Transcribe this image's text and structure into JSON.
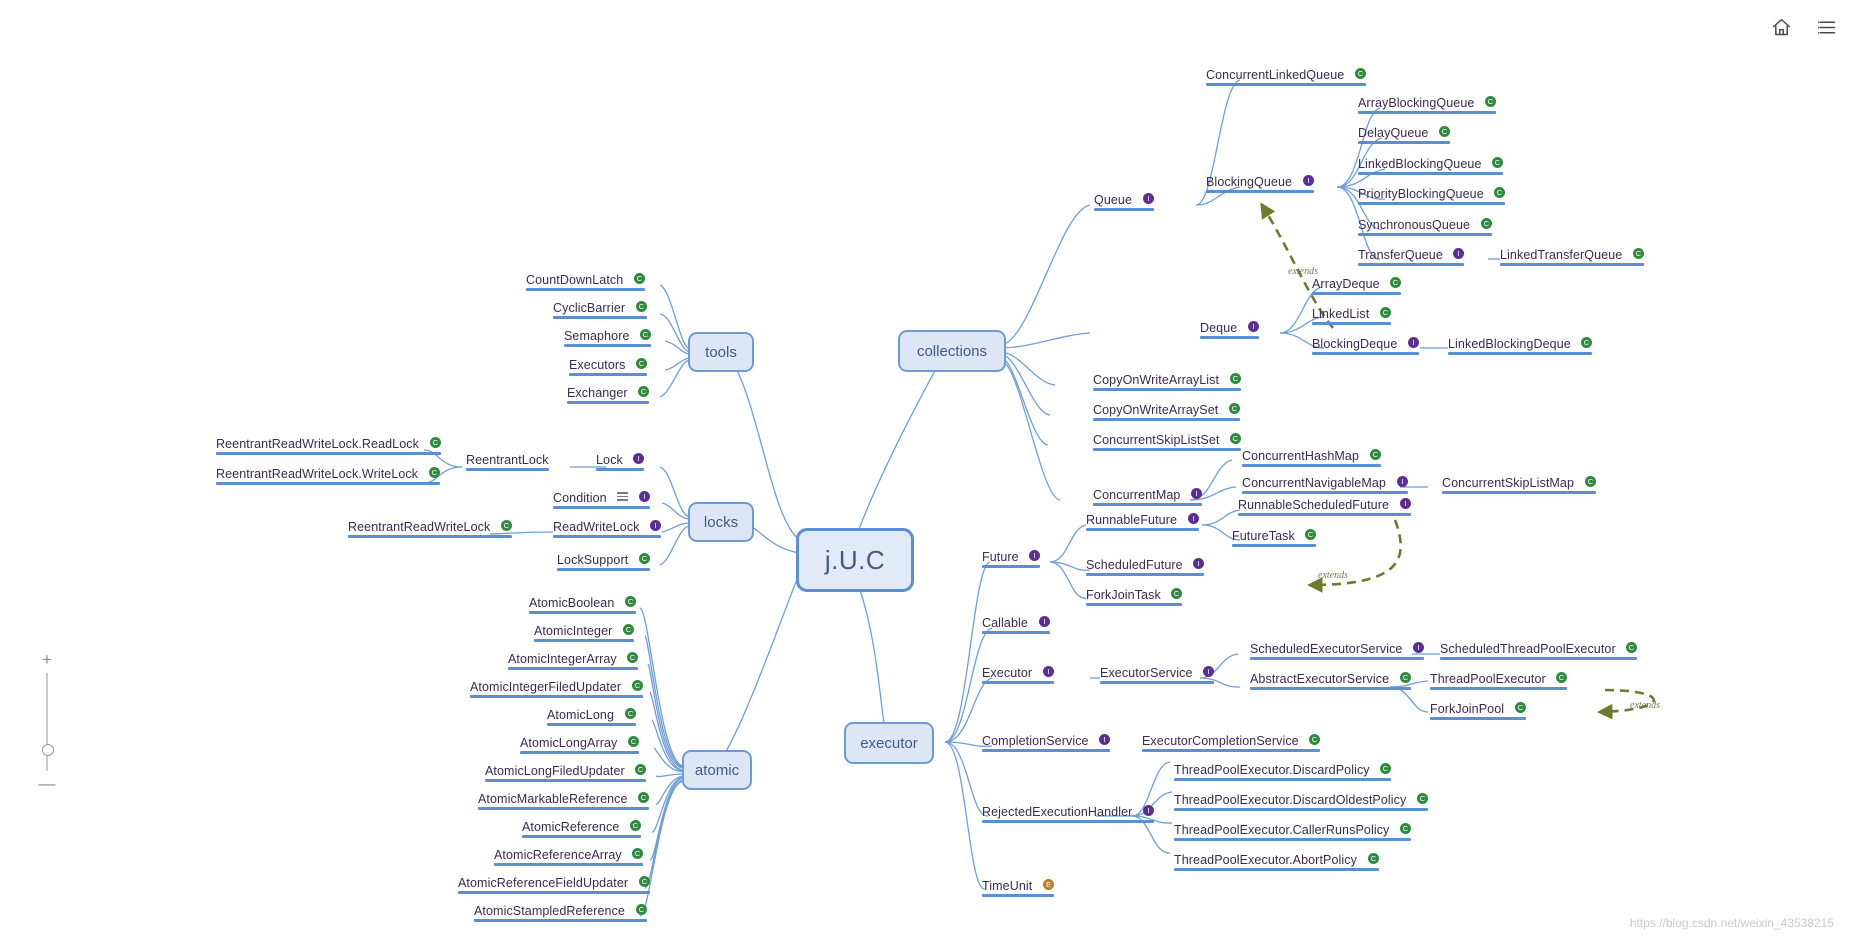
{
  "root": {
    "label": "j.U.C"
  },
  "toolbar": {
    "home_icon": "home-icon",
    "menu_icon": "list-menu-icon"
  },
  "zoom": {
    "plus": "+",
    "minus": "—"
  },
  "watermark": "https://blog.csdn.net/weixin_43538215",
  "relations": [
    {
      "label": "extends",
      "from": "ArrayDeque",
      "to": "BlockingQueue"
    },
    {
      "label": "extends",
      "from": "RunnableScheduledFuture",
      "to": "ScheduledFuture"
    },
    {
      "label": "extends",
      "from": "ThreadPoolExecutor",
      "to": "ScheduledThreadPoolExecutor"
    }
  ],
  "branches": {
    "tools": {
      "label": "tools"
    },
    "locks": {
      "label": "locks"
    },
    "atomic": {
      "label": "atomic"
    },
    "collections": {
      "label": "collections"
    },
    "executor": {
      "label": "executor"
    }
  },
  "nodes": {
    "tools_children": [
      {
        "label": "CountDownLatch",
        "kind": "class"
      },
      {
        "label": "CyclicBarrier",
        "kind": "class"
      },
      {
        "label": "Semaphore",
        "kind": "class"
      },
      {
        "label": "Executors",
        "kind": "class"
      },
      {
        "label": "Exchanger",
        "kind": "class"
      }
    ],
    "locks_children": [
      {
        "label": "Lock",
        "kind": "interface"
      },
      {
        "label": "Condition",
        "kind": "interface",
        "menu": true
      },
      {
        "label": "ReadWriteLock",
        "kind": "interface"
      },
      {
        "label": "LockSupport",
        "kind": "class"
      }
    ],
    "lock_children": [
      {
        "label": "ReentrantLock",
        "kind": "none"
      }
    ],
    "reentrantlock_children": [
      {
        "label": "ReentrantReadWriteLock.ReadLock",
        "kind": "class"
      },
      {
        "label": "ReentrantReadWriteLock.WriteLock",
        "kind": "class"
      }
    ],
    "readwritelock_children": [
      {
        "label": "ReentrantReadWriteLock",
        "kind": "class"
      }
    ],
    "atomic_children": [
      {
        "label": "AtomicBoolean",
        "kind": "class"
      },
      {
        "label": "AtomicInteger",
        "kind": "class"
      },
      {
        "label": "AtomicIntegerArray",
        "kind": "class"
      },
      {
        "label": "AtomicIntegerFiledUpdater",
        "kind": "class"
      },
      {
        "label": "AtomicLong",
        "kind": "class"
      },
      {
        "label": "AtomicLongArray",
        "kind": "class"
      },
      {
        "label": "AtomicLongFiledUpdater",
        "kind": "class"
      },
      {
        "label": "AtomicMarkableReference",
        "kind": "class"
      },
      {
        "label": "AtomicReference",
        "kind": "class"
      },
      {
        "label": "AtomicReferenceArray",
        "kind": "class"
      },
      {
        "label": "AtomicReferenceFieldUpdater",
        "kind": "class"
      },
      {
        "label": "AtomicStampledReference",
        "kind": "class"
      }
    ],
    "collections_children": [
      {
        "label": "Queue",
        "kind": "interface"
      },
      {
        "label": "Deque",
        "kind": "interface"
      },
      {
        "label": "CopyOnWriteArrayList",
        "kind": "class"
      },
      {
        "label": "CopyOnWriteArraySet",
        "kind": "class"
      },
      {
        "label": "ConcurrentSkipListSet",
        "kind": "class"
      },
      {
        "label": "ConcurrentMap",
        "kind": "interface"
      }
    ],
    "queue_children": [
      {
        "label": "ConcurrentLinkedQueue",
        "kind": "class"
      },
      {
        "label": "BlockingQueue",
        "kind": "interface"
      }
    ],
    "blockingqueue_children": [
      {
        "label": "ArrayBlockingQueue",
        "kind": "class"
      },
      {
        "label": "DelayQueue",
        "kind": "class"
      },
      {
        "label": "LinkedBlockingQueue",
        "kind": "class"
      },
      {
        "label": "PriorityBlockingQueue",
        "kind": "class"
      },
      {
        "label": "SynchronousQueue",
        "kind": "class"
      },
      {
        "label": "TransferQueue",
        "kind": "interface"
      }
    ],
    "transferqueue_children": [
      {
        "label": "LinkedTransferQueue",
        "kind": "class"
      }
    ],
    "deque_children": [
      {
        "label": "ArrayDeque",
        "kind": "class"
      },
      {
        "label": "LinkedList",
        "kind": "class"
      },
      {
        "label": "BlockingDeque",
        "kind": "interface"
      }
    ],
    "blockingdeque_children": [
      {
        "label": "LinkedBlockingDeque",
        "kind": "class"
      }
    ],
    "concurrentmap_children": [
      {
        "label": "ConcurrentHashMap",
        "kind": "class"
      },
      {
        "label": "ConcurrentNavigableMap",
        "kind": "interface"
      }
    ],
    "concurrentnavigablemap_children": [
      {
        "label": "ConcurrentSkipListMap",
        "kind": "class"
      }
    ],
    "executor_children": [
      {
        "label": "Future",
        "kind": "interface"
      },
      {
        "label": "Callable",
        "kind": "interface"
      },
      {
        "label": "Executor",
        "kind": "interface"
      },
      {
        "label": "CompletionService",
        "kind": "interface"
      },
      {
        "label": "RejectedExecutionHandler",
        "kind": "interface"
      },
      {
        "label": "TimeUnit",
        "kind": "enum"
      }
    ],
    "future_children": [
      {
        "label": "RunnableFuture",
        "kind": "interface"
      },
      {
        "label": "ScheduledFuture",
        "kind": "interface"
      },
      {
        "label": "ForkJoinTask",
        "kind": "class"
      }
    ],
    "runnablefuture_children": [
      {
        "label": "RunnableScheduledFuture",
        "kind": "interface"
      },
      {
        "label": "FutureTask",
        "kind": "class"
      }
    ],
    "executor_if_children": [
      {
        "label": "ExecutorService",
        "kind": "interface"
      }
    ],
    "executorservice_children": [
      {
        "label": "ScheduledExecutorService",
        "kind": "interface"
      },
      {
        "label": "AbstractExecutorService",
        "kind": "class"
      }
    ],
    "scheduledexecutorservice_children": [
      {
        "label": "ScheduledThreadPoolExecutor",
        "kind": "class"
      }
    ],
    "abstractexecutorservice_children": [
      {
        "label": "ThreadPoolExecutor",
        "kind": "class"
      },
      {
        "label": "ForkJoinPool",
        "kind": "class"
      }
    ],
    "completionservice_children": [
      {
        "label": "ExecutorCompletionService",
        "kind": "class"
      }
    ],
    "rejectedexecutionhandler_children": [
      {
        "label": "ThreadPoolExecutor.DiscardPolicy",
        "kind": "class"
      },
      {
        "label": "ThreadPoolExecutor.DiscardOldestPolicy",
        "kind": "class"
      },
      {
        "label": "ThreadPoolExecutor.CallerRunsPolicy",
        "kind": "class"
      },
      {
        "label": "ThreadPoolExecutor.AbortPolicy",
        "kind": "class"
      }
    ]
  },
  "colors": {
    "line": "#5b8fd4",
    "bar": "#5b8fd4",
    "box_fill": "#dce6f5",
    "box_border": "#6e9ad6",
    "text": "#3b2a53",
    "interface_marker": "#5b2f91",
    "class_marker": "#2f8a3e",
    "relation": "#6f7a2e"
  }
}
